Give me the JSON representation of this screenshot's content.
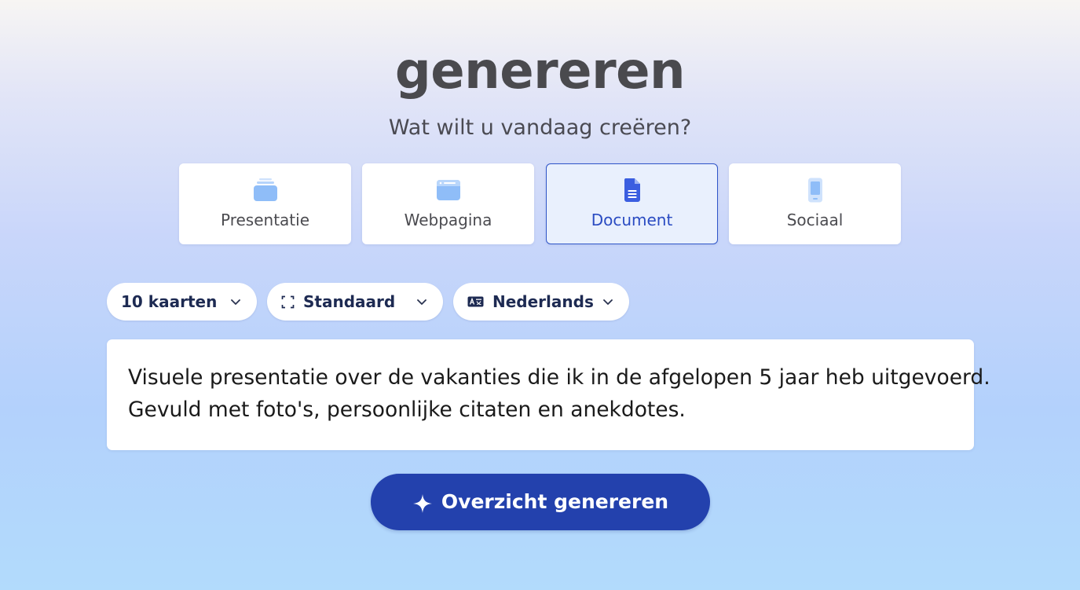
{
  "header": {
    "title": "genereren",
    "subtitle": "Wat wilt u vandaag creëren?"
  },
  "content_types": [
    {
      "label": "Presentatie",
      "icon": "presentation-icon",
      "selected": false
    },
    {
      "label": "Webpagina",
      "icon": "webpage-icon",
      "selected": false
    },
    {
      "label": "Document",
      "icon": "document-icon",
      "selected": true
    },
    {
      "label": "Sociaal",
      "icon": "phone-icon",
      "selected": false
    }
  ],
  "options": {
    "cards": {
      "value": "10 kaarten"
    },
    "format": {
      "value": "Standaard",
      "icon": "frame-icon"
    },
    "language": {
      "value": "Nederlands",
      "icon": "translate-icon"
    }
  },
  "prompt": {
    "line1": "Visuele presentatie over de vakanties die ik in de afgelopen 5 jaar heb uitgevoerd.",
    "line2": "Gevuld met foto's, persoonlijke citaten en anekdotes."
  },
  "generate_button": {
    "label": "Overzicht genereren",
    "icon": "sparkle-icon"
  },
  "colors": {
    "accent": "#2341ad",
    "selected_border": "#2f55c9",
    "selected_bg": "#e9f0fd",
    "icon_light_blue": "#8fbdf8",
    "icon_dark_blue": "#3b5ee0"
  }
}
